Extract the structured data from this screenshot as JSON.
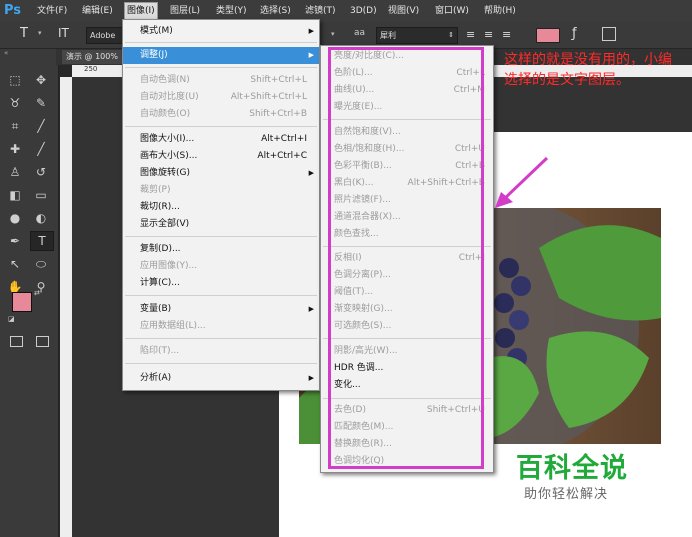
{
  "app": {
    "logo": "Ps"
  },
  "menubar": {
    "items": [
      "文件(F)",
      "编辑(E)",
      "图像(I)",
      "图层(L)",
      "类型(Y)",
      "选择(S)",
      "滤镜(T)",
      "3D(D)",
      "视图(V)",
      "窗口(W)",
      "帮助(H)"
    ],
    "active_index": 2
  },
  "options": {
    "font_family": "Adobe",
    "aa_label": "aa",
    "aa_mode": "犀利"
  },
  "document": {
    "tab_label": "演示 @ 100%",
    "ruler_mark": "250"
  },
  "image_menu": {
    "items": [
      {
        "label": "模式(M)",
        "shortcut": "",
        "submenu": true,
        "disabled": false
      },
      {
        "label": "调整(J)",
        "shortcut": "",
        "submenu": true,
        "disabled": false,
        "highlighted": true
      },
      {
        "label": "自动色调(N)",
        "shortcut": "Shift+Ctrl+L",
        "disabled": true
      },
      {
        "label": "自动对比度(U)",
        "shortcut": "Alt+Shift+Ctrl+L",
        "disabled": true
      },
      {
        "label": "自动颜色(O)",
        "shortcut": "Shift+Ctrl+B",
        "disabled": true
      },
      {
        "label": "图像大小(I)...",
        "shortcut": "Alt+Ctrl+I",
        "disabled": false
      },
      {
        "label": "画布大小(S)...",
        "shortcut": "Alt+Ctrl+C",
        "disabled": false
      },
      {
        "label": "图像旋转(G)",
        "shortcut": "",
        "submenu": true,
        "disabled": false
      },
      {
        "label": "裁剪(P)",
        "shortcut": "",
        "disabled": true
      },
      {
        "label": "裁切(R)...",
        "shortcut": "",
        "disabled": false
      },
      {
        "label": "显示全部(V)",
        "shortcut": "",
        "disabled": false
      },
      {
        "label": "复制(D)...",
        "shortcut": "",
        "disabled": false
      },
      {
        "label": "应用图像(Y)...",
        "shortcut": "",
        "disabled": true
      },
      {
        "label": "计算(C)...",
        "shortcut": "",
        "disabled": false
      },
      {
        "label": "变量(B)",
        "shortcut": "",
        "submenu": true,
        "disabled": false
      },
      {
        "label": "应用数据组(L)...",
        "shortcut": "",
        "disabled": true
      },
      {
        "label": "陷印(T)...",
        "shortcut": "",
        "disabled": true
      },
      {
        "label": "分析(A)",
        "shortcut": "",
        "submenu": true,
        "disabled": false
      }
    ]
  },
  "adjust_menu": {
    "items": [
      {
        "label": "亮度/对比度(C)...",
        "shortcut": "",
        "disabled": true
      },
      {
        "label": "色阶(L)...",
        "shortcut": "Ctrl+L",
        "disabled": true
      },
      {
        "label": "曲线(U)...",
        "shortcut": "Ctrl+M",
        "disabled": true
      },
      {
        "label": "曝光度(E)...",
        "shortcut": "",
        "disabled": true
      },
      {
        "label": "自然饱和度(V)...",
        "shortcut": "",
        "disabled": true
      },
      {
        "label": "色相/饱和度(H)...",
        "shortcut": "Ctrl+U",
        "disabled": true
      },
      {
        "label": "色彩平衡(B)...",
        "shortcut": "Ctrl+B",
        "disabled": true
      },
      {
        "label": "黑白(K)...",
        "shortcut": "Alt+Shift+Ctrl+B",
        "disabled": true
      },
      {
        "label": "照片滤镜(F)...",
        "shortcut": "",
        "disabled": true
      },
      {
        "label": "通道混合器(X)...",
        "shortcut": "",
        "disabled": true
      },
      {
        "label": "颜色查找...",
        "shortcut": "",
        "disabled": true
      },
      {
        "label": "反相(I)",
        "shortcut": "Ctrl+I",
        "disabled": true
      },
      {
        "label": "色调分离(P)...",
        "shortcut": "",
        "disabled": true
      },
      {
        "label": "阈值(T)...",
        "shortcut": "",
        "disabled": true
      },
      {
        "label": "渐变映射(G)...",
        "shortcut": "",
        "disabled": true
      },
      {
        "label": "可选颜色(S)...",
        "shortcut": "",
        "disabled": true
      },
      {
        "label": "阴影/高光(W)...",
        "shortcut": "",
        "disabled": true
      },
      {
        "label": "HDR 色调...",
        "shortcut": "",
        "disabled": false
      },
      {
        "label": "变化...",
        "shortcut": "",
        "disabled": false
      },
      {
        "label": "去色(D)",
        "shortcut": "Shift+Ctrl+U",
        "disabled": true
      },
      {
        "label": "匹配颜色(M)...",
        "shortcut": "",
        "disabled": true
      },
      {
        "label": "替换颜色(R)...",
        "shortcut": "",
        "disabled": true
      },
      {
        "label": "色调均化(Q)",
        "shortcut": "",
        "disabled": true
      }
    ]
  },
  "annotation": {
    "text": "这样的就是没有用的，小编选择的是文字图层。"
  },
  "watermark": {
    "main": "百科全说",
    "sub": "助你轻松解决"
  },
  "colors": {
    "menu_highlight": "#3a90d8",
    "annotation": "#ff2a2a",
    "frame": "#d23cc8",
    "brand": "#1faa3a",
    "foreground_swatch": "#e8899a",
    "background_swatch": "#f0747e",
    "text_color_swatch": "#e8899a"
  },
  "icons": {
    "tools": [
      "marquee-icon",
      "move-icon",
      "lasso-icon",
      "quick-select-icon",
      "crop-icon",
      "eyedropper-icon",
      "healing-icon",
      "brush-icon",
      "stamp-icon",
      "history-brush-icon",
      "eraser-icon",
      "gradient-icon",
      "blur-icon",
      "dodge-icon",
      "pen-icon",
      "type-icon",
      "path-select-icon",
      "shape-icon",
      "hand-icon",
      "zoom-icon"
    ]
  }
}
